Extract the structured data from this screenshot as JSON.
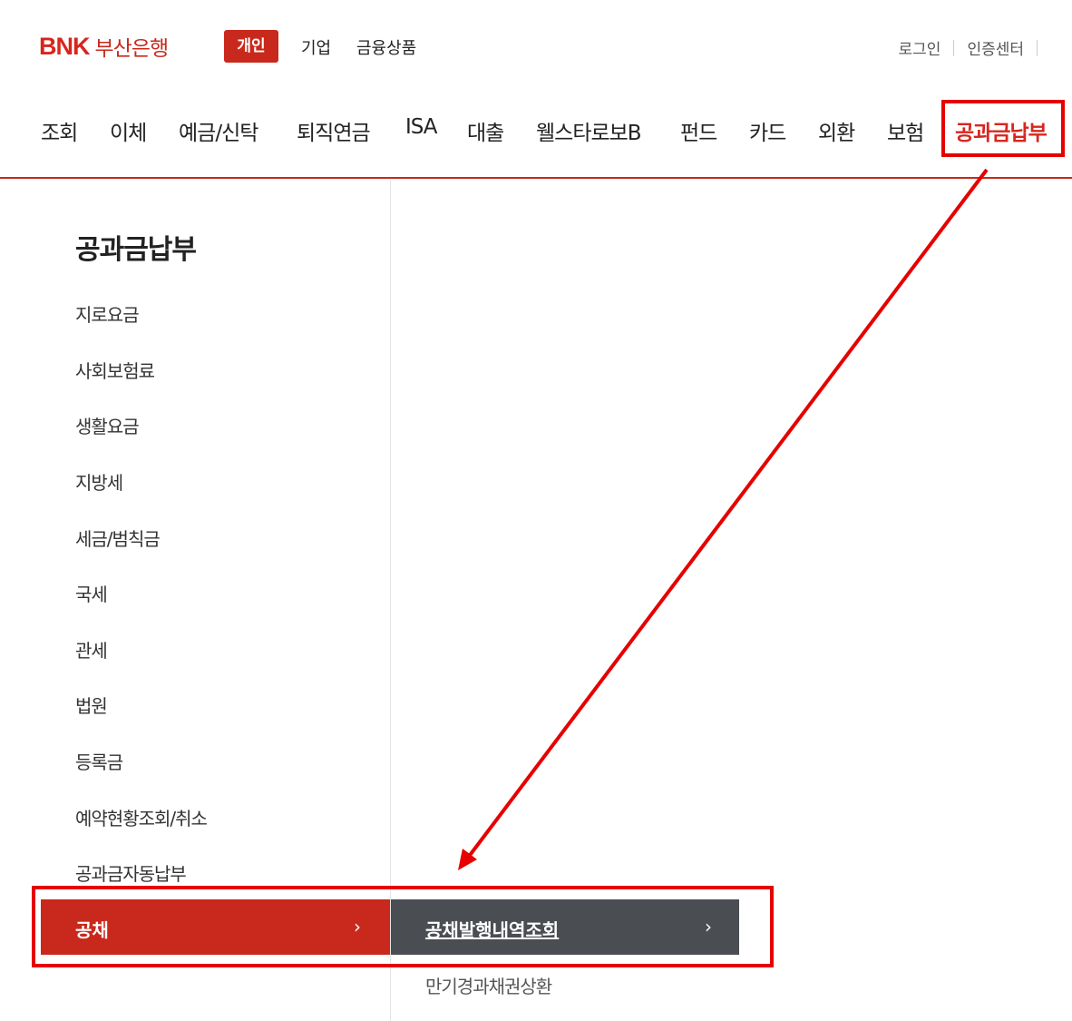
{
  "brand": {
    "logo_text": "BNK",
    "bank_name": "부산은행"
  },
  "customer_types": {
    "personal": "개인",
    "corporate": "기업",
    "products": "금융상품"
  },
  "utility": {
    "login": "로그인",
    "cert_center": "인증센터"
  },
  "gnb": [
    "조회",
    "이체",
    "예금/신탁",
    "퇴직연금",
    "ISA",
    "대출",
    "웰스타로보B",
    "펀드",
    "카드",
    "외환",
    "보험",
    "공과금납부"
  ],
  "lnb": {
    "title": "공과금납부",
    "items": [
      "지로요금",
      "사회보험료",
      "생활요금",
      "지방세",
      "세금/범칙금",
      "국세",
      "관세",
      "법원",
      "등록금",
      "예약현황조회/취소",
      "공과금자동납부"
    ],
    "active": "공채",
    "sub_active": "공채발행내역조회",
    "sub_items": [
      "만기경과채권상환"
    ]
  },
  "colors": {
    "brand_red": "#c8291c",
    "highlight_red": "#e60000",
    "sub_bg": "#4a4d52"
  }
}
